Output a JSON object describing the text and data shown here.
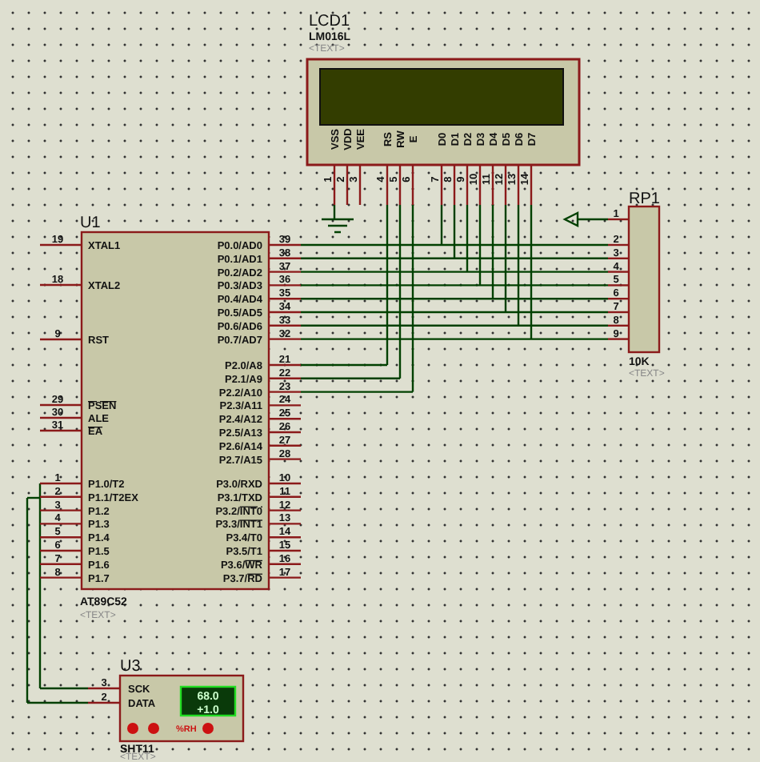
{
  "lcd": {
    "ref": "LCD1",
    "part": "LM016L",
    "text": "<TEXT>",
    "pins": [
      {
        "name": "VSS",
        "number": "1"
      },
      {
        "name": "VDD",
        "number": "2"
      },
      {
        "name": "VEE",
        "number": "3"
      },
      {
        "name": "RS",
        "number": "4"
      },
      {
        "name": "RW",
        "number": "5"
      },
      {
        "name": "E",
        "number": "6"
      },
      {
        "name": "D0",
        "number": "7"
      },
      {
        "name": "D1",
        "number": "8"
      },
      {
        "name": "D2",
        "number": "9"
      },
      {
        "name": "D3",
        "number": "10"
      },
      {
        "name": "D4",
        "number": "11"
      },
      {
        "name": "D5",
        "number": "12"
      },
      {
        "name": "D6",
        "number": "13"
      },
      {
        "name": "D7",
        "number": "14"
      }
    ]
  },
  "resistor_pack": {
    "ref": "RP1",
    "value": "10K",
    "text": "<TEXT>",
    "pins": [
      "1",
      "2",
      "3",
      "4",
      "5",
      "6",
      "7",
      "8",
      "9"
    ]
  },
  "mcu": {
    "ref": "U1",
    "part": "AT89C52",
    "text": "<TEXT>",
    "left_pins": [
      {
        "name": "XTAL1",
        "number": "19"
      },
      {
        "name": "XTAL2",
        "number": "18"
      },
      {
        "name": "RST",
        "number": "9"
      },
      {
        "inverted": "PSEN",
        "number": "29"
      },
      {
        "name": "ALE",
        "number": "30"
      },
      {
        "inverted": "EA",
        "number": "31"
      },
      {
        "name": "P1.0/T2",
        "number": "1"
      },
      {
        "name": "P1.1/T2EX",
        "number": "2"
      },
      {
        "name": "P1.2",
        "number": "3"
      },
      {
        "name": "P1.3",
        "number": "4"
      },
      {
        "name": "P1.4",
        "number": "5"
      },
      {
        "name": "P1.5",
        "number": "6"
      },
      {
        "name": "P1.6",
        "number": "7"
      },
      {
        "name": "P1.7",
        "number": "8"
      }
    ],
    "right_pins": [
      {
        "name": "P0.0/AD0",
        "number": "39"
      },
      {
        "name": "P0.1/AD1",
        "number": "38"
      },
      {
        "name": "P0.2/AD2",
        "number": "37"
      },
      {
        "name": "P0.3/AD3",
        "number": "36"
      },
      {
        "name": "P0.4/AD4",
        "number": "35"
      },
      {
        "name": "P0.5/AD5",
        "number": "34"
      },
      {
        "name": "P0.6/AD6",
        "number": "33"
      },
      {
        "name": "P0.7/AD7",
        "number": "32"
      },
      {
        "name": "P2.0/A8",
        "number": "21"
      },
      {
        "name": "P2.1/A9",
        "number": "22"
      },
      {
        "name": "P2.2/A10",
        "number": "23"
      },
      {
        "name": "P2.3/A11",
        "number": "24"
      },
      {
        "name": "P2.4/A12",
        "number": "25"
      },
      {
        "name": "P2.5/A13",
        "number": "26"
      },
      {
        "name": "P2.6/A14",
        "number": "27"
      },
      {
        "name": "P2.7/A15",
        "number": "28"
      },
      {
        "name": "P3.0/RXD",
        "number": "10"
      },
      {
        "name": "P3.1/TXD",
        "number": "11"
      },
      {
        "name": "P3.2/",
        "inverted": "INT0",
        "number": "12"
      },
      {
        "name": "P3.3/",
        "inverted": "INT1",
        "number": "13"
      },
      {
        "name": "P3.4/T0",
        "number": "14"
      },
      {
        "name": "P3.5/T1",
        "number": "15"
      },
      {
        "name": "P3.6/",
        "inverted": "WR",
        "number": "16"
      },
      {
        "name": "P3.7/",
        "inverted": "RD",
        "number": "17"
      }
    ]
  },
  "sensor": {
    "ref": "U3",
    "part": "SHT11",
    "text": "<TEXT>",
    "pins": [
      {
        "name": "SCK",
        "number": "3"
      },
      {
        "name": "DATA",
        "number": "2"
      }
    ],
    "humidity": "68.0",
    "temperature": "+1.0",
    "unit": "%RH"
  }
}
